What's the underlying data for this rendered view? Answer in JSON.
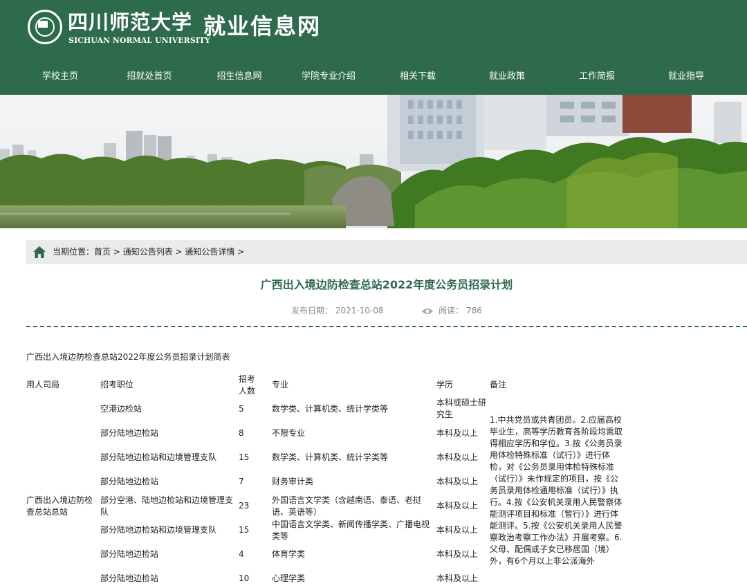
{
  "header": {
    "university_cn": "四川师范大学",
    "university_en": "SICHUAN NORMAL UNIVERSITY",
    "site_title": "就业信息网",
    "logo": "university-seal-icon"
  },
  "nav": [
    "学校主页",
    "招就处首页",
    "招生信息网",
    "学院专业介绍",
    "相关下载",
    "就业政策",
    "工作简报",
    "就业指导"
  ],
  "colors": {
    "primary": "#2e6a4c",
    "breadcrumb_bg": "#eaecea",
    "meta": "#888888"
  },
  "breadcrumb": {
    "prefix": "当期位置：",
    "items": [
      "首页",
      "通知公告列表",
      "通知公告详情"
    ],
    "sep": " > ",
    "icon": "home-icon"
  },
  "article": {
    "title": "广西出入境边防检查总站2022年度公务员招录计划",
    "date_label": "发布日期：",
    "date": "2021-10-08",
    "views_label": "阅读：",
    "views": "786",
    "views_icon": "eye-icon",
    "intro": "广西出入境边防检查总站2022年度公务员招录计划简表"
  },
  "table": {
    "headers": [
      "用人司局",
      "招考职位",
      "招考人数",
      "专业",
      "学历",
      "备注"
    ],
    "agency": "广西出入境边防检查总站总站",
    "rows": [
      {
        "position": "空港边检站",
        "count": "5",
        "major": "数学类、计算机类、统计学类等",
        "education": "本科或硕士研究生"
      },
      {
        "position": "部分陆地边检站",
        "count": "8",
        "major": "不限专业",
        "education": "本科及以上"
      },
      {
        "position": "部分陆地边检站和边境管理支队",
        "count": "15",
        "major": "数学类、计算机类、统计学类等",
        "education": "本科及以上"
      },
      {
        "position": "部分陆地边检站",
        "count": "7",
        "major": "财务审计类",
        "education": "本科及以上"
      },
      {
        "position": "部分空港、陆地边检站和边境管理支队",
        "count": "23",
        "major": "外国语言文学类（含越南语、泰语、老挝语、英语等）",
        "education": "本科及以上"
      },
      {
        "position": "部分陆地边检站和边境管理支队",
        "count": "15",
        "major": "中国语言文学类、新闻传播学类、广播电视类等",
        "education": "本科及以上"
      },
      {
        "position": "部分陆地边检站",
        "count": "4",
        "major": "体育学类",
        "education": "本科及以上"
      },
      {
        "position": "部分陆地边检站",
        "count": "10",
        "major": "心理学类",
        "education": "本科及以上"
      }
    ],
    "remarks": "1.中共党员或共青团员。2.应届高校毕业生，高等学历教育各阶段均需取得相应学历和学位。3.按《公务员录用体检特殊标准（试行）》进行体检，对《公务员录用体检特殊标准（试行）》未作规定的项目，按《公务员录用体检通用标准（试行）》执行。4.按《公安机关录用人民警察体能测评项目和标准（暂行）》进行体能测评。5.按《公安机关录用人民警察政治考察工作办法》开展考察。6.父母、配偶或子女已移居国（境）外，有6个月以上非公派海外"
  }
}
